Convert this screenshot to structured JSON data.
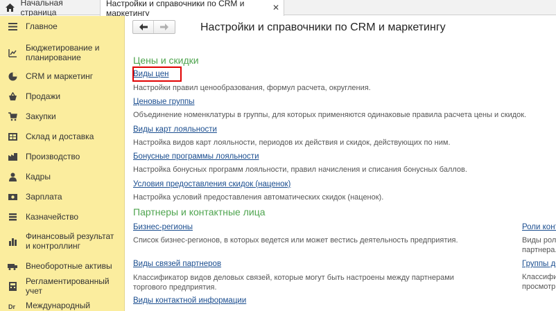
{
  "tabs": {
    "home_label": "Начальная страница",
    "active_label": "Настройки и справочники по CRM и маркетингу",
    "close_glyph": "✕"
  },
  "sidebar": {
    "items": [
      {
        "label": "Главное",
        "icon": "menu-icon"
      },
      {
        "label": "Бюджетирование и планирование",
        "icon": "budget-icon"
      },
      {
        "label": "CRM и маркетинг",
        "icon": "pie-chart-icon"
      },
      {
        "label": "Продажи",
        "icon": "sales-icon"
      },
      {
        "label": "Закупки",
        "icon": "cart-icon"
      },
      {
        "label": "Склад и доставка",
        "icon": "warehouse-icon"
      },
      {
        "label": "Производство",
        "icon": "factory-icon"
      },
      {
        "label": "Кадры",
        "icon": "person-icon"
      },
      {
        "label": "Зарплата",
        "icon": "salary-icon"
      },
      {
        "label": "Казначейство",
        "icon": "treasury-icon"
      },
      {
        "label": "Финансовый результат и контроллинг",
        "icon": "chart-icon"
      },
      {
        "label": "Внеоборотные активы",
        "icon": "assets-icon"
      },
      {
        "label": "Регламентированный учет",
        "icon": "calculator-icon"
      },
      {
        "label": "Международный",
        "icon": "international-icon"
      }
    ]
  },
  "main": {
    "title": "Настройки и справочники по CRM и маркетингу",
    "nav": {
      "back": "🡐",
      "forward": "🡒"
    },
    "sections": [
      {
        "title": "Цены и скидки",
        "entries": [
          {
            "link": "Виды цен",
            "desc": "Настройки правил ценообразования, формул расчета, округления."
          },
          {
            "link": "Ценовые группы",
            "desc": "Объединение номенклатуры в группы, для которых применяются одинаковые правила расчета цены и скидок."
          },
          {
            "link": "Виды карт лояльности",
            "desc": "Настройка видов карт лояльности, периодов их действия и скидок, действующих по ним."
          },
          {
            "link": "Бонусные программы лояльности",
            "desc": "Настройка бонусных программ лояльности, правил начисления и списания бонусных баллов."
          },
          {
            "link": "Условия предоставления скидок (наценок)",
            "desc": "Настройка условий предоставления автоматических скидок (наценок)."
          }
        ]
      },
      {
        "title": "Партнеры и контактные лица",
        "entries": [
          {
            "link": "Бизнес-регионы",
            "desc": "Список бизнес-регионов, в которых ведется или может вестись деятельность предприятия."
          },
          {
            "link": "Виды связей партнеров",
            "desc": "Классификатор видов деловых связей, которые могут быть настроены между партнерами торгового предприятия."
          },
          {
            "link": "Виды контактной информации",
            "desc": ""
          }
        ],
        "right_entries": [
          {
            "link": "Роли конт",
            "desc_line1": "Виды рол",
            "desc_line2": "партнера."
          },
          {
            "link": "Группы до",
            "desc_line1": "Классифи",
            "desc_line2": "просмотр,"
          }
        ]
      }
    ]
  },
  "colors": {
    "sidebar_bg": "#fbed9e",
    "section_title": "#4ea44e",
    "link": "#1a4d8f",
    "highlight_border": "#e00000"
  }
}
